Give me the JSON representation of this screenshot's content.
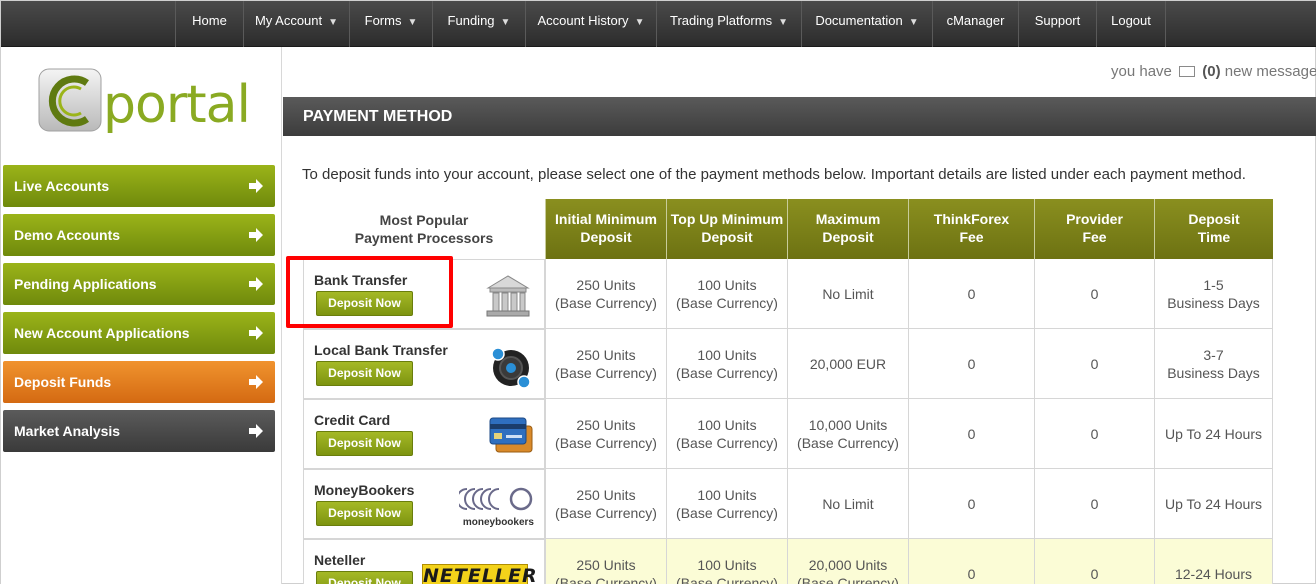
{
  "nav": {
    "items": [
      {
        "label": "Home",
        "dropdown": false
      },
      {
        "label": "My Account",
        "dropdown": true
      },
      {
        "label": "Forms",
        "dropdown": true
      },
      {
        "label": "Funding",
        "dropdown": true
      },
      {
        "label": "Account History",
        "dropdown": true
      },
      {
        "label": "Trading Platforms",
        "dropdown": true
      },
      {
        "label": "Documentation",
        "dropdown": true
      },
      {
        "label": "cManager",
        "dropdown": false
      },
      {
        "label": "Support",
        "dropdown": false
      },
      {
        "label": "Logout",
        "dropdown": false
      }
    ],
    "arrow_glyph": "▼"
  },
  "logo": {
    "text": "portal",
    "accent": "#8aaa22"
  },
  "sidebar": {
    "items": [
      {
        "label": "Live Accounts",
        "style": "green"
      },
      {
        "label": "Demo Accounts",
        "style": "green"
      },
      {
        "label": "Pending Applications",
        "style": "green"
      },
      {
        "label": "New Account Applications",
        "style": "green"
      },
      {
        "label": "Deposit Funds",
        "style": "orange"
      },
      {
        "label": "Market Analysis",
        "style": "dark"
      }
    ]
  },
  "messages": {
    "prefix": "you have",
    "count": "(0)",
    "suffix": "new message"
  },
  "page": {
    "title": "PAYMENT METHOD",
    "intro": "To deposit funds into your account, please select one of the payment methods below. Important details are listed under each payment method."
  },
  "table": {
    "first_header": [
      "Most Popular",
      "Payment Processors"
    ],
    "headers": [
      [
        "Initial Minimum",
        "Deposit"
      ],
      [
        "Top Up Minimum",
        "Deposit"
      ],
      [
        "Maximum",
        "Deposit"
      ],
      [
        "ThinkForex",
        "Fee"
      ],
      [
        "Provider",
        "Fee"
      ],
      [
        "Deposit",
        "Time"
      ]
    ],
    "button_label": "Deposit Now",
    "rows": [
      {
        "name": "Bank Transfer",
        "icon": "bank-icon",
        "cells": [
          [
            "250 Units",
            "(Base Currency)"
          ],
          [
            "100 Units",
            "(Base Currency)"
          ],
          [
            "No Limit"
          ],
          [
            "0"
          ],
          [
            "0"
          ],
          [
            "1-5",
            "Business Days"
          ]
        ],
        "highlight": false
      },
      {
        "name": "Local Bank Transfer",
        "icon": "local-bank-icon",
        "cells": [
          [
            "250 Units",
            "(Base Currency)"
          ],
          [
            "100 Units",
            "(Base Currency)"
          ],
          [
            "20,000 EUR"
          ],
          [
            "0"
          ],
          [
            "0"
          ],
          [
            "3-7",
            "Business Days"
          ]
        ],
        "highlight": false
      },
      {
        "name": "Credit Card",
        "icon": "credit-card-icon",
        "cells": [
          [
            "250 Units",
            "(Base Currency)"
          ],
          [
            "100 Units",
            "(Base Currency)"
          ],
          [
            "10,000 Units",
            "(Base Currency)"
          ],
          [
            "0"
          ],
          [
            "0"
          ],
          [
            "Up To 24 Hours"
          ]
        ],
        "highlight": false
      },
      {
        "name": "MoneyBookers",
        "icon": "moneybookers-logo",
        "logo_text": "moneybookers",
        "cells": [
          [
            "250 Units",
            "(Base Currency)"
          ],
          [
            "100 Units",
            "(Base Currency)"
          ],
          [
            "No Limit"
          ],
          [
            "0"
          ],
          [
            "0"
          ],
          [
            "Up To 24 Hours"
          ]
        ],
        "highlight": false
      },
      {
        "name": "Neteller",
        "icon": "neteller-logo",
        "logo_text": "NETELLER",
        "cells": [
          [
            "250 Units",
            "(Base Currency)"
          ],
          [
            "100 Units",
            "(Base Currency)"
          ],
          [
            "20,000 Units",
            "(Base Currency)"
          ],
          [
            "0"
          ],
          [
            "0"
          ],
          [
            "12-24 Hours"
          ]
        ],
        "highlight": true
      }
    ]
  },
  "colors": {
    "header_olive": "#7a7f18",
    "button_green": "#8fa61a",
    "highlight_red": "#ff0000",
    "row_highlight": "#fbfcd6"
  }
}
